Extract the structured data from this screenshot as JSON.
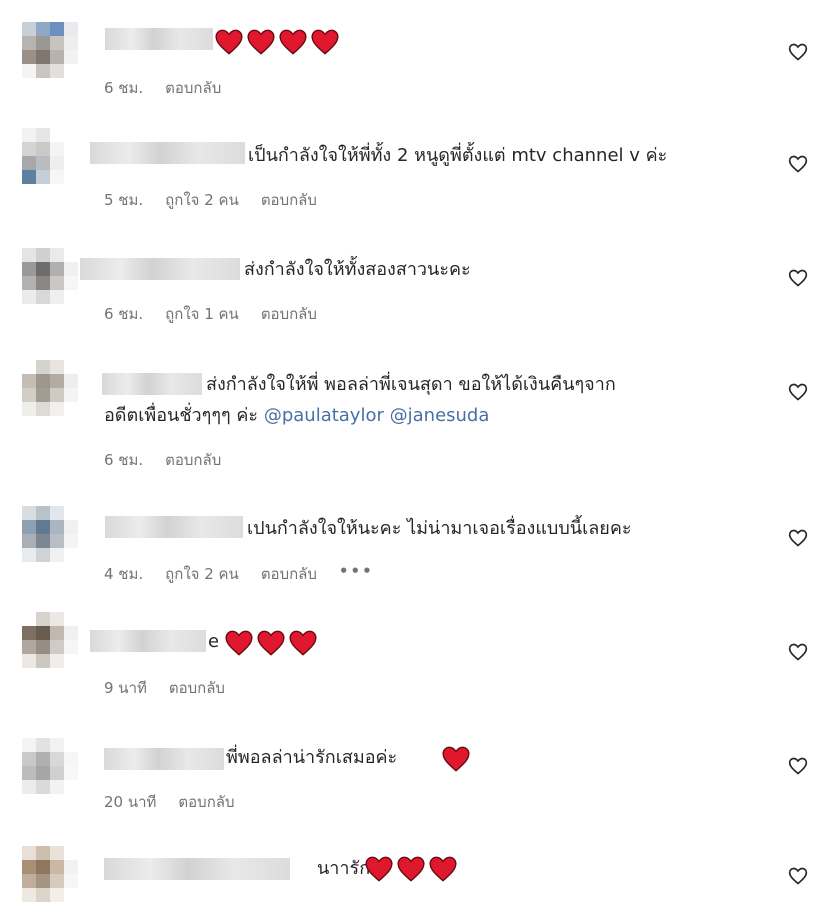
{
  "comments": [
    {
      "text": "",
      "hearts": 4,
      "time": "6 ชม.",
      "likes": "",
      "reply": "ตอบกลับ",
      "more": ""
    },
    {
      "text": "เป็นกำลังใจให้พี่ทั้ง 2 หนูดูพี่ตั้งแต่ mtv channel v ค่ะ",
      "hearts": 0,
      "time": "5 ชม.",
      "likes": "ถูกใจ 2 คน",
      "reply": "ตอบกลับ",
      "more": ""
    },
    {
      "text": "ส่งกำลังใจให้ทั้งสองสาวนะคะ",
      "hearts": 0,
      "time": "6 ชม.",
      "likes": "ถูกใจ 1 คน",
      "reply": "ตอบกลับ",
      "more": ""
    },
    {
      "text": "ส่งกำลังใจให้พี่ พอลล่าพี่เจนสุดา ขอให้ได้เงินคืนๆจาก",
      "text2": "อดีตเพื่อนชั่วๆๆๆ ค่ะ",
      "mention1": "@paulataylor",
      "mention2": "@janesuda",
      "hearts": 0,
      "time": "6 ชม.",
      "likes": "",
      "reply": "ตอบกลับ",
      "more": ""
    },
    {
      "text": "เปนกำลังใจให้นะคะ ไม่น่ามาเจอเรื่องแบบนี้เลยคะ",
      "hearts": 0,
      "time": "4 ชม.",
      "likes": "ถูกใจ 2 คน",
      "reply": "ตอบกลับ",
      "more": "•••"
    },
    {
      "text": "e",
      "hearts": 3,
      "time": "9 นาที",
      "likes": "",
      "reply": "ตอบกลับ",
      "more": ""
    },
    {
      "text": "พี่พอลล่าน่ารักเสมอค่ะ",
      "hearts": 1,
      "time": "20 นาที",
      "likes": "",
      "reply": "ตอบกลับ",
      "more": ""
    },
    {
      "text": "นาารัก",
      "hearts": 3,
      "time": "",
      "likes": "",
      "reply": "",
      "more": ""
    }
  ],
  "icons": {
    "heart": "heart-emoji",
    "like": "heart-outline-icon"
  },
  "colors": {
    "heart": "#e0182d",
    "meta": "#737373",
    "mention": "#4a6fa5"
  }
}
